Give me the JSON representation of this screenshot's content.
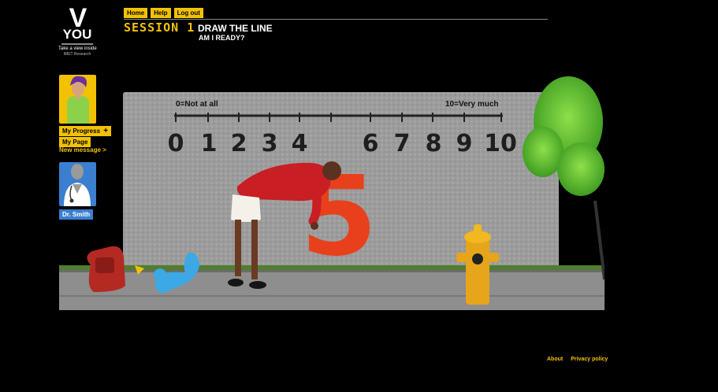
{
  "logo": {
    "letter": "V",
    "word": "YOU",
    "tagline": "Take a view inside",
    "org": "IMET Research"
  },
  "nav": {
    "home": "Home",
    "help": "Help",
    "logout": "Log out"
  },
  "header": {
    "session": "SESSION 1",
    "title": "DRAW THE LINE",
    "subtitle": "AM I READY?"
  },
  "sidebar": {
    "progress": "My Progress",
    "progress_icon": "+",
    "page": "My Page",
    "new_message": "New message >",
    "doctor": "Dr. Smith"
  },
  "scale": {
    "low_label": "0=Not at all",
    "high_label": "10=Very much",
    "numbers": [
      "0",
      "1",
      "2",
      "3",
      "4",
      "6",
      "7",
      "8",
      "9",
      "10"
    ],
    "painted_number": "5",
    "painted_color": "#e8401c"
  },
  "footer": {
    "about": "About",
    "privacy": "Privacy policy"
  },
  "colors": {
    "accent": "#f2c200",
    "doctor": "#3a7fd0",
    "background": "#000000"
  }
}
